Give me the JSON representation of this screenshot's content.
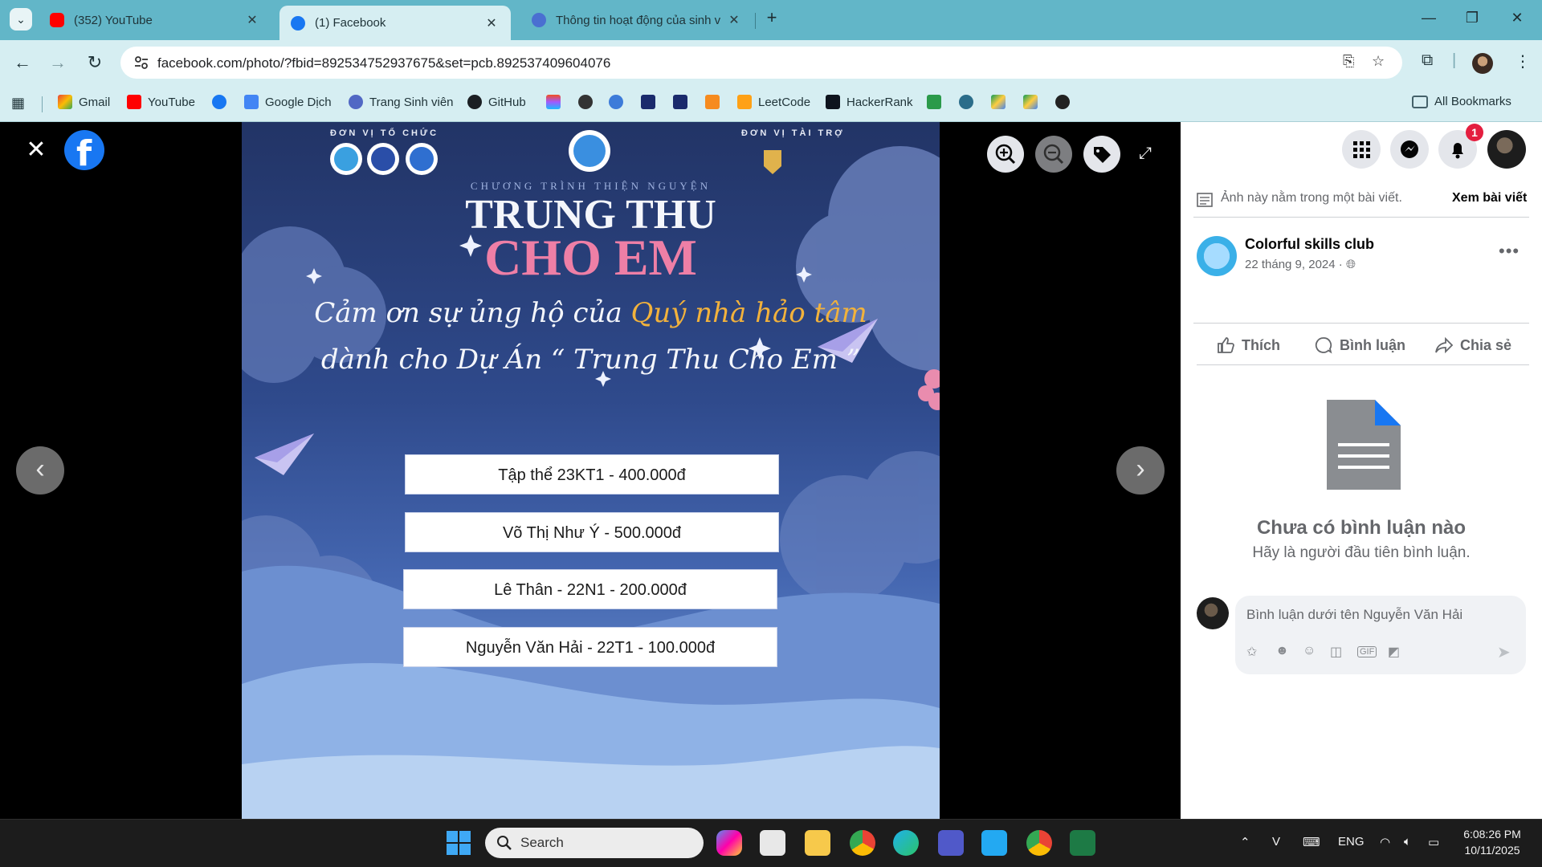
{
  "browser": {
    "tabs": [
      {
        "title": "(352) YouTube",
        "favicon": "youtube-icon",
        "active": false
      },
      {
        "title": "(1) Facebook",
        "favicon": "facebook-icon",
        "active": true
      },
      {
        "title": "Thông tin hoạt động của sinh v",
        "favicon": "university-icon",
        "active": false
      }
    ],
    "url": "facebook.com/photo/?fbid=892534752937675&set=pcb.892537409604076",
    "bookmarks": [
      {
        "label": "Gmail",
        "icon": "gmail-icon"
      },
      {
        "label": "YouTube",
        "icon": "youtube-icon"
      },
      {
        "label": "",
        "icon": "facebook-icon"
      },
      {
        "label": "Google Dịch",
        "icon": "google-translate-icon"
      },
      {
        "label": "Trang Sinh viên",
        "icon": "university-icon"
      },
      {
        "label": "GitHub",
        "icon": "github-icon"
      },
      {
        "label": "LeetCode",
        "icon": "leetcode-icon"
      },
      {
        "label": "HackerRank",
        "icon": "hackerrank-icon"
      }
    ],
    "all_bookmarks": "All Bookmarks"
  },
  "poster": {
    "organizer_label": "ĐƠN VỊ TỔ CHỨC",
    "sponsor_label": "ĐƠN VỊ TÀI TRỢ",
    "program": "CHƯƠNG TRÌNH THIỆN NGUYỆN",
    "title_line1": "TRUNG THU",
    "title_line2": "CHO EM",
    "thanks_prefix": "Cảm ơn sự ủng hộ của",
    "thanks_highlight": "Quý nhà hảo tâm",
    "thanks_line2": "dành cho Dự Án “ Trung Thu Cho Em ”",
    "donors": [
      "Tập thể 23KT1 - 400.000đ",
      "Võ Thị Như Ý - 500.000đ",
      "Lê Thân - 22N1 - 200.000đ",
      "Nguyễn Văn Hải - 22T1 - 100.000đ"
    ]
  },
  "panel": {
    "notification_count": "1",
    "post_hint": "Ảnh này nằm trong một bài viết.",
    "view_post": "Xem bài viết",
    "author": "Colorful skills club",
    "date": "22 tháng 9, 2024 ·",
    "actions": {
      "like": "Thích",
      "comment": "Bình luận",
      "share": "Chia sẻ"
    },
    "no_comments_title": "Chưa có bình luận nào",
    "no_comments_sub": "Hãy là người đầu tiên bình luận.",
    "comment_placeholder": "Bình luận dưới tên Nguyễn Văn Hải"
  },
  "taskbar": {
    "search": "Search",
    "lang": "ENG",
    "time": "6:08:26 PM",
    "date": "10/11/2025"
  },
  "colors": {
    "facebook_blue": "#1877f2",
    "tab_bar": "#62b6c8",
    "poster_pink": "#ee7fa6",
    "poster_gold": "#f2b23c"
  }
}
